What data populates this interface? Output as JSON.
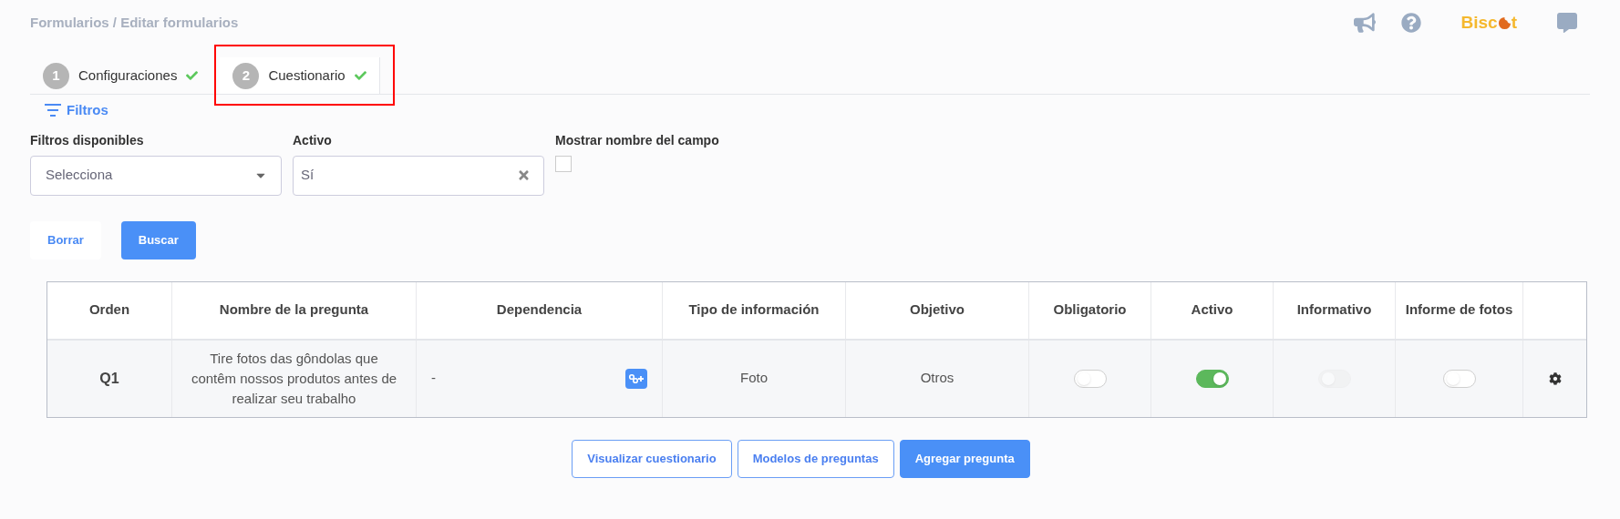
{
  "breadcrumb": "Formularios / Editar formularios",
  "header": {
    "logo": {
      "before": "Bisc",
      "after": "t"
    }
  },
  "tabs": [
    {
      "number": "1",
      "label": "Configuraciones",
      "selected": false,
      "done": true,
      "highlighted": false
    },
    {
      "number": "2",
      "label": "Cuestionario",
      "selected": true,
      "done": true,
      "highlighted": true
    }
  ],
  "filters_toggle": "Filtros",
  "filters": [
    {
      "kind": "select",
      "label": "Filtros disponibles",
      "placeholder": "Selecciona"
    },
    {
      "kind": "clearable",
      "label": "Activo",
      "value": "Sí"
    },
    {
      "kind": "checkbox",
      "label": "Mostrar nombre del campo",
      "checked": false
    }
  ],
  "filter_buttons": [
    {
      "label": "Borrar",
      "kind": "plain"
    },
    {
      "label": "Buscar",
      "kind": "primary"
    }
  ],
  "table": {
    "columns": [
      "Orden",
      "Nombre de la pregunta",
      "Dependencia",
      "Tipo de información",
      "Objetivo",
      "Obligatorio",
      "Activo",
      "Informativo",
      "Informe de fotos"
    ],
    "rows": [
      {
        "order": "Q1",
        "question": "Tire fotos das gôndolas que contêm nossos produtos antes de realizar seu trabalho",
        "dependency": "-",
        "type": "Foto",
        "objective": "Otros",
        "toggles": [
          {
            "on": false,
            "disabled": false
          },
          {
            "on": true,
            "disabled": false
          },
          {
            "on": false,
            "disabled": true
          },
          {
            "on": false,
            "disabled": false
          }
        ]
      }
    ]
  },
  "actions": [
    {
      "label": "Visualizar cuestionario",
      "kind": "outline"
    },
    {
      "label": "Modelos de preguntas",
      "kind": "outline"
    },
    {
      "label": "Agregar pregunta",
      "kind": "primary"
    }
  ]
}
